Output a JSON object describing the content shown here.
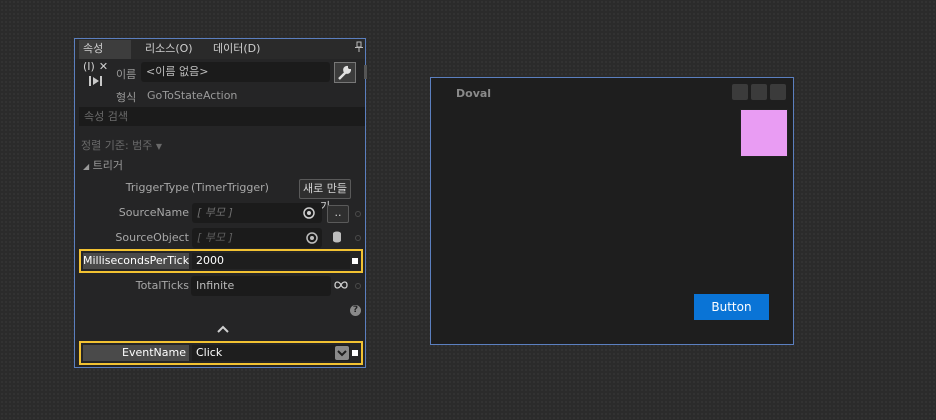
{
  "properties_panel": {
    "tabs": [
      {
        "label": "속성(I)",
        "active": true
      },
      {
        "label": "리소스(O)",
        "active": false
      },
      {
        "label": "데이터(D)",
        "active": false
      }
    ],
    "name_label": "이름",
    "name_value": "<이름 없음>",
    "type_label": "형식",
    "type_value": "GoToStateAction",
    "search_placeholder": "속성 검색",
    "sort_label": "정렬 기준: 범주",
    "category": "트리거",
    "properties": {
      "trigger_type_label": "TriggerType",
      "trigger_type_value": "(TimerTrigger)",
      "new_button": "새로 만들기",
      "source_name_label": "SourceName",
      "source_name_value": "[ 부모 ]",
      "ellipsis_button": "..",
      "source_object_label": "SourceObject",
      "source_object_value": "[ 부모 ]",
      "ms_per_tick_label": "MillisecondsPerTick",
      "ms_per_tick_value": "2000",
      "total_ticks_label": "TotalTicks",
      "total_ticks_value": "Infinite",
      "event_name_label": "EventName",
      "event_name_value": "Click"
    }
  },
  "design_canvas": {
    "title": "Doval",
    "button_label": "Button",
    "accent_color": "#0a74d6",
    "square_color": "#e99cf3",
    "highlight_color": "#f2c232"
  }
}
